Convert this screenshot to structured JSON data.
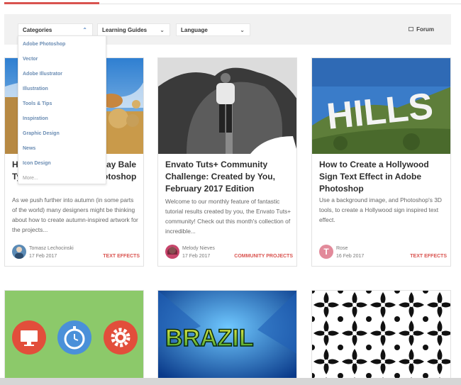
{
  "filters": {
    "categories": "Categories",
    "learning_guides": "Learning Guides",
    "language": "Language",
    "forum": "Forum"
  },
  "dropdown": {
    "items": [
      "Adobe Photoshop",
      "Vector",
      "Adobe Illustrator",
      "Illustration",
      "Tools & Tips",
      "Inspiration",
      "Graphic Design",
      "News",
      "Icon Design"
    ],
    "more": "More..."
  },
  "cards": [
    {
      "title_fragments": [
        "Ho",
        "ay Bale",
        "Ty",
        "otoshop"
      ],
      "excerpt": "As we push further into autumn (in some parts of the world) many designers might be thinking about how to create autumn-inspired artwork for the projects...",
      "author": "Tomasz Lechocinski",
      "date": "17 Feb 2017",
      "category": "TEXT EFFECTS"
    },
    {
      "title": "Envato Tuts+ Community Challenge: Created by You, February 2017 Edition",
      "excerpt": "Welcome to our monthly feature of fantastic tutorial results created by you, the Envato Tuts+ community! Check out this month's collection of incredible...",
      "author": "Melody Nieves",
      "date": "17 Feb 2017",
      "category": "COMMUNITY PROJECTS"
    },
    {
      "title": "How to Create a Hollywood Sign Text Effect in Adobe Photoshop",
      "excerpt": "Use a background image, and Photoshop's 3D tools, to create a Hollywood sign inspired text effect.",
      "author": "Rose",
      "date": "16 Feb 2017",
      "category": "TEXT EFFECTS",
      "image_text": "HILLS",
      "avatar_letter": "T"
    },
    {
      "icon_names": [
        "monitor-icon",
        "stopwatch-icon",
        "gear-icon"
      ]
    },
    {
      "image_text": "BRAZIL"
    },
    {
      "image_name": "damask-pattern"
    }
  ],
  "colors": {
    "accent_red": "#d9534f",
    "link_blue": "#6a8cb3",
    "filter_bg": "#f1f1f1",
    "hollywood_sky": "#3a7cc9",
    "flat_green": "#8cc96a",
    "icon_red": "#e24e3b",
    "icon_blue": "#4a90d9"
  }
}
